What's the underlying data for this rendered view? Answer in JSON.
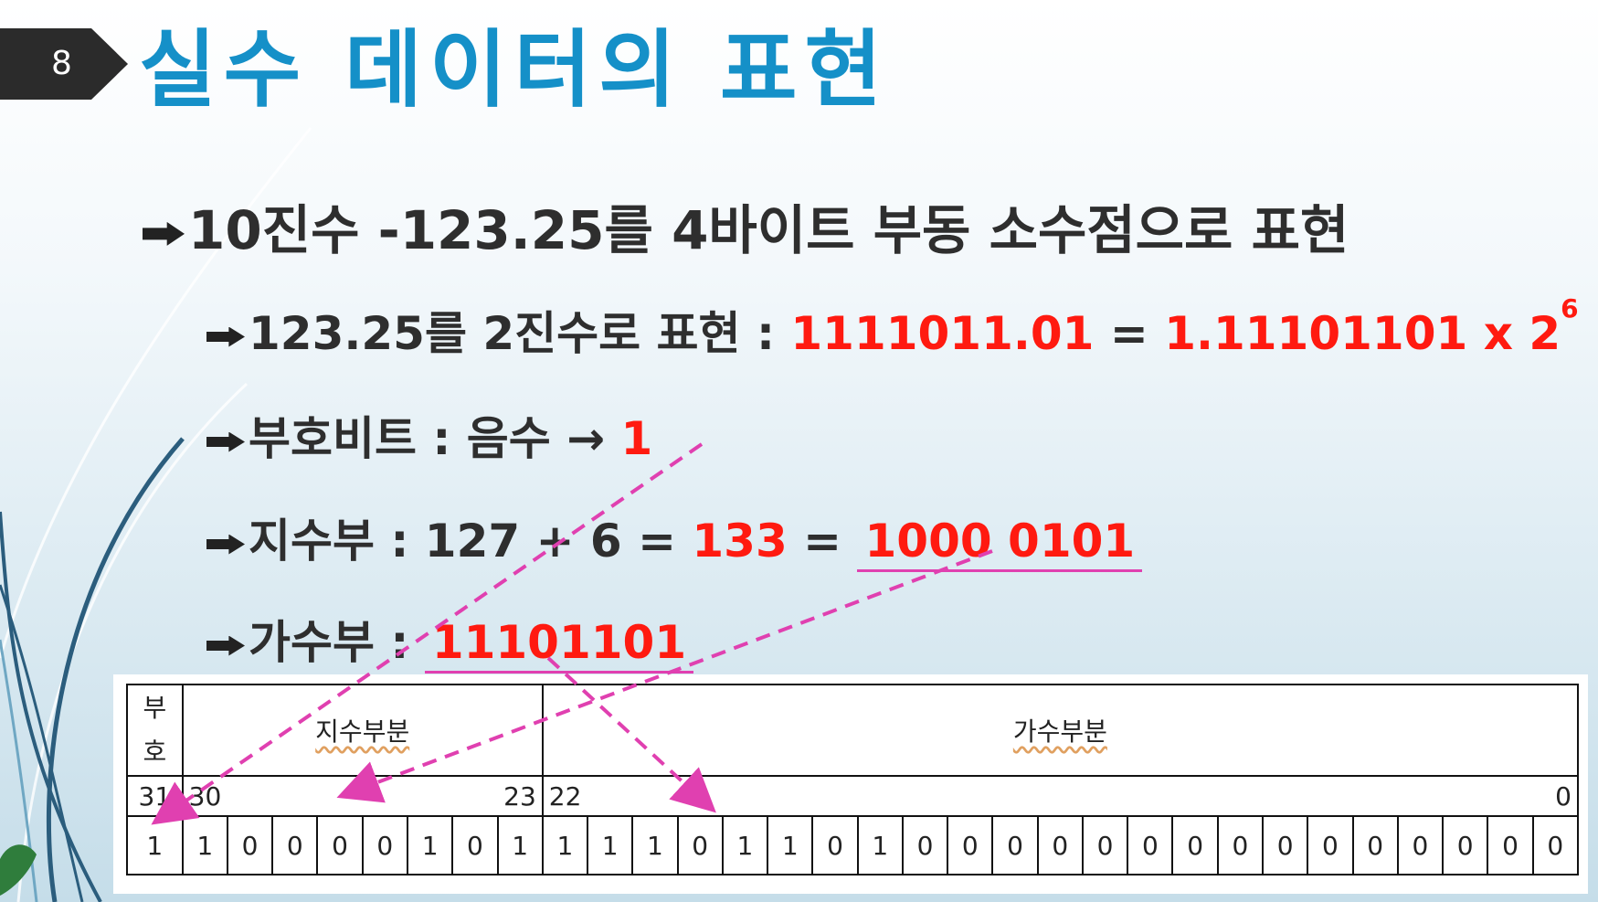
{
  "slide_number": "8",
  "title": "실수 데이터의 표현",
  "bullets": {
    "b1": {
      "text": "10진수 -123.25를 4바이트 부동 소수점으로 표현"
    },
    "b2": {
      "prefix": "123.25를 2진수로 표현 : ",
      "binary": "1111011.01",
      "eq": " = ",
      "normalized": "1.11101101 x 2",
      "exponent": "6"
    },
    "b3": {
      "prefix": "부호비트 : 음수 → ",
      "value": "1"
    },
    "b4": {
      "prefix": "지수부 : 127 + 6 = ",
      "value": "133",
      "eq": " = ",
      "binary": "1000 0101"
    },
    "b5": {
      "prefix": "가수부 : ",
      "binary": "11101101"
    }
  },
  "table": {
    "sign_label": "부\n호",
    "sign_label_top": "부",
    "sign_label_bottom": "호",
    "exponent_label": "지수부분",
    "mantissa_label": "가수부분",
    "index_31": "31",
    "index_30": "30",
    "index_23": "23",
    "index_22": "22",
    "index_0": "0",
    "bits": [
      "1",
      "1",
      "0",
      "0",
      "0",
      "0",
      "1",
      "0",
      "1",
      "1",
      "1",
      "1",
      "0",
      "1",
      "1",
      "0",
      "1",
      "0",
      "0",
      "0",
      "0",
      "0",
      "0",
      "0",
      "0",
      "0",
      "0",
      "0",
      "0",
      "0",
      "0",
      "0"
    ]
  },
  "colors": {
    "title": "#1590c8",
    "highlight": "#ff1a10",
    "dashed_arrow": "#e040b0"
  }
}
